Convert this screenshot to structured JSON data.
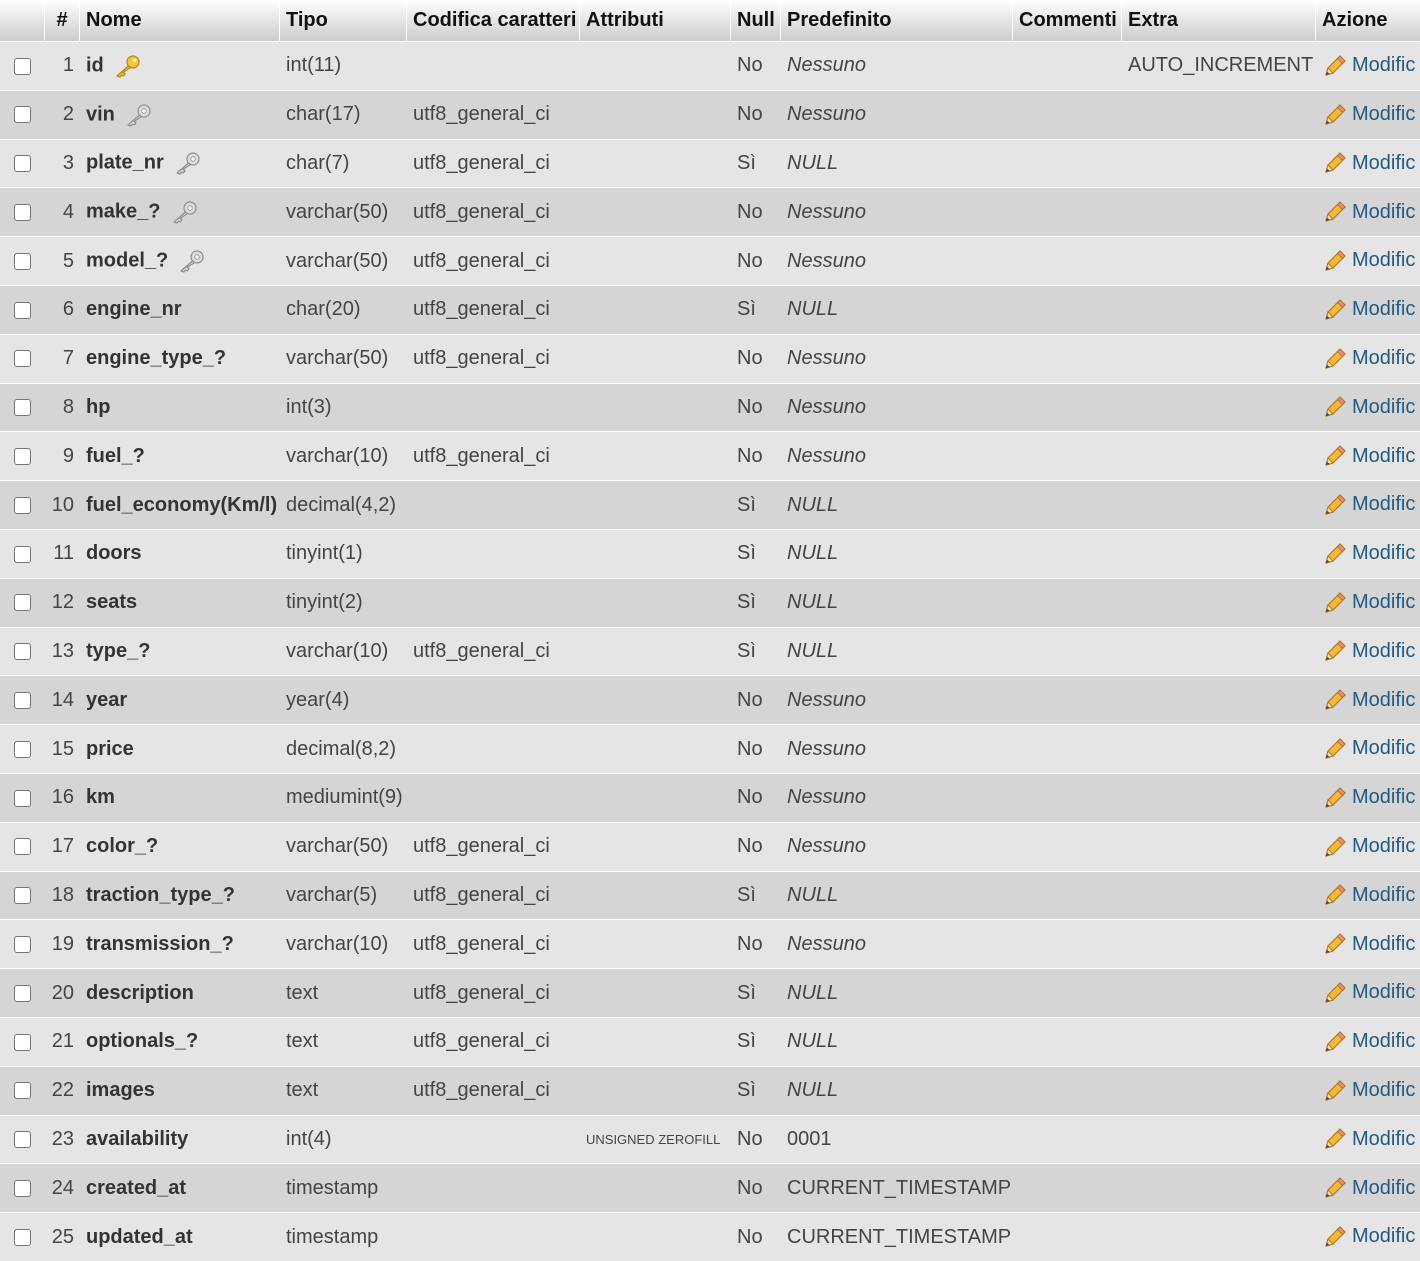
{
  "headers": {
    "num": "#",
    "name": "Nome",
    "type": "Tipo",
    "collation": "Codifica caratteri",
    "attributes": "Attributi",
    "null": "Null",
    "default": "Predefinito",
    "comments": "Commenti",
    "extra": "Extra",
    "action": "Azione"
  },
  "action_label": "Modific",
  "rows": [
    {
      "num": "1",
      "name": "id",
      "key": "primary",
      "type": "int(11)",
      "collation": "",
      "attributes": "",
      "null": "No",
      "default": "Nessuno",
      "default_italic": true,
      "comments": "",
      "extra": "AUTO_INCREMENT"
    },
    {
      "num": "2",
      "name": "vin",
      "key": "index",
      "type": "char(17)",
      "collation": "utf8_general_ci",
      "attributes": "",
      "null": "No",
      "default": "Nessuno",
      "default_italic": true,
      "comments": "",
      "extra": ""
    },
    {
      "num": "3",
      "name": "plate_nr",
      "key": "index",
      "type": "char(7)",
      "collation": "utf8_general_ci",
      "attributes": "",
      "null": "Sì",
      "default": "NULL",
      "default_italic": true,
      "comments": "",
      "extra": ""
    },
    {
      "num": "4",
      "name": "make_?",
      "key": "index",
      "type": "varchar(50)",
      "collation": "utf8_general_ci",
      "attributes": "",
      "null": "No",
      "default": "Nessuno",
      "default_italic": true,
      "comments": "",
      "extra": ""
    },
    {
      "num": "5",
      "name": "model_?",
      "key": "index",
      "type": "varchar(50)",
      "collation": "utf8_general_ci",
      "attributes": "",
      "null": "No",
      "default": "Nessuno",
      "default_italic": true,
      "comments": "",
      "extra": ""
    },
    {
      "num": "6",
      "name": "engine_nr",
      "key": "",
      "type": "char(20)",
      "collation": "utf8_general_ci",
      "attributes": "",
      "null": "Sì",
      "default": "NULL",
      "default_italic": true,
      "comments": "",
      "extra": ""
    },
    {
      "num": "7",
      "name": "engine_type_?",
      "key": "",
      "type": "varchar(50)",
      "collation": "utf8_general_ci",
      "attributes": "",
      "null": "No",
      "default": "Nessuno",
      "default_italic": true,
      "comments": "",
      "extra": ""
    },
    {
      "num": "8",
      "name": "hp",
      "key": "",
      "type": "int(3)",
      "collation": "",
      "attributes": "",
      "null": "No",
      "default": "Nessuno",
      "default_italic": true,
      "comments": "",
      "extra": ""
    },
    {
      "num": "9",
      "name": "fuel_?",
      "key": "",
      "type": "varchar(10)",
      "collation": "utf8_general_ci",
      "attributes": "",
      "null": "No",
      "default": "Nessuno",
      "default_italic": true,
      "comments": "",
      "extra": ""
    },
    {
      "num": "10",
      "name": "fuel_economy(Km/l)",
      "key": "",
      "type": "decimal(4,2)",
      "collation": "",
      "attributes": "",
      "null": "Sì",
      "default": "NULL",
      "default_italic": true,
      "comments": "",
      "extra": ""
    },
    {
      "num": "11",
      "name": "doors",
      "key": "",
      "type": "tinyint(1)",
      "collation": "",
      "attributes": "",
      "null": "Sì",
      "default": "NULL",
      "default_italic": true,
      "comments": "",
      "extra": ""
    },
    {
      "num": "12",
      "name": "seats",
      "key": "",
      "type": "tinyint(2)",
      "collation": "",
      "attributes": "",
      "null": "Sì",
      "default": "NULL",
      "default_italic": true,
      "comments": "",
      "extra": ""
    },
    {
      "num": "13",
      "name": "type_?",
      "key": "",
      "type": "varchar(10)",
      "collation": "utf8_general_ci",
      "attributes": "",
      "null": "Sì",
      "default": "NULL",
      "default_italic": true,
      "comments": "",
      "extra": ""
    },
    {
      "num": "14",
      "name": "year",
      "key": "",
      "type": "year(4)",
      "collation": "",
      "attributes": "",
      "null": "No",
      "default": "Nessuno",
      "default_italic": true,
      "comments": "",
      "extra": ""
    },
    {
      "num": "15",
      "name": "price",
      "key": "",
      "type": "decimal(8,2)",
      "collation": "",
      "attributes": "",
      "null": "No",
      "default": "Nessuno",
      "default_italic": true,
      "comments": "",
      "extra": ""
    },
    {
      "num": "16",
      "name": "km",
      "key": "",
      "type": "mediumint(9)",
      "collation": "",
      "attributes": "",
      "null": "No",
      "default": "Nessuno",
      "default_italic": true,
      "comments": "",
      "extra": ""
    },
    {
      "num": "17",
      "name": "color_?",
      "key": "",
      "type": "varchar(50)",
      "collation": "utf8_general_ci",
      "attributes": "",
      "null": "No",
      "default": "Nessuno",
      "default_italic": true,
      "comments": "",
      "extra": ""
    },
    {
      "num": "18",
      "name": "traction_type_?",
      "key": "",
      "type": "varchar(5)",
      "collation": "utf8_general_ci",
      "attributes": "",
      "null": "Sì",
      "default": "NULL",
      "default_italic": true,
      "comments": "",
      "extra": ""
    },
    {
      "num": "19",
      "name": "transmission_?",
      "key": "",
      "type": "varchar(10)",
      "collation": "utf8_general_ci",
      "attributes": "",
      "null": "No",
      "default": "Nessuno",
      "default_italic": true,
      "comments": "",
      "extra": ""
    },
    {
      "num": "20",
      "name": "description",
      "key": "",
      "type": "text",
      "collation": "utf8_general_ci",
      "attributes": "",
      "null": "Sì",
      "default": "NULL",
      "default_italic": true,
      "comments": "",
      "extra": ""
    },
    {
      "num": "21",
      "name": "optionals_?",
      "key": "",
      "type": "text",
      "collation": "utf8_general_ci",
      "attributes": "",
      "null": "Sì",
      "default": "NULL",
      "default_italic": true,
      "comments": "",
      "extra": ""
    },
    {
      "num": "22",
      "name": "images",
      "key": "",
      "type": "text",
      "collation": "utf8_general_ci",
      "attributes": "",
      "null": "Sì",
      "default": "NULL",
      "default_italic": true,
      "comments": "",
      "extra": ""
    },
    {
      "num": "23",
      "name": "availability",
      "key": "",
      "type": "int(4)",
      "collation": "",
      "attributes": "UNSIGNED ZEROFILL",
      "null": "No",
      "default": "0001",
      "default_italic": false,
      "comments": "",
      "extra": ""
    },
    {
      "num": "24",
      "name": "created_at",
      "key": "",
      "type": "timestamp",
      "collation": "",
      "attributes": "",
      "null": "No",
      "default": "CURRENT_TIMESTAMP",
      "default_italic": false,
      "comments": "",
      "extra": ""
    },
    {
      "num": "25",
      "name": "updated_at",
      "key": "",
      "type": "timestamp",
      "collation": "",
      "attributes": "",
      "null": "No",
      "default": "CURRENT_TIMESTAMP",
      "default_italic": false,
      "comments": "",
      "extra": ""
    }
  ]
}
